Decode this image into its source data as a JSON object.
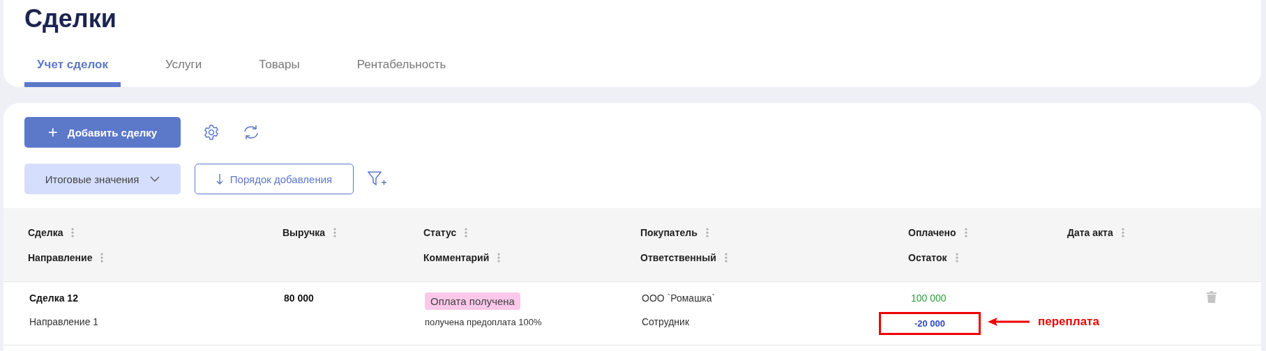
{
  "page": {
    "title": "Сделки"
  },
  "tabs": [
    {
      "label": "Учет сделок",
      "selected": true
    },
    {
      "label": "Услуги",
      "selected": false
    },
    {
      "label": "Товары",
      "selected": false
    },
    {
      "label": "Рентабельность",
      "selected": false
    }
  ],
  "toolbar": {
    "add_button": "+",
    "add_label": "Добавить сделку",
    "totals_dropdown": "Итоговые значения",
    "sort_button": "Порядок добавления"
  },
  "table": {
    "columns": [
      {
        "top": "Сделка",
        "bottom": "Направление"
      },
      {
        "top": "Выручка"
      },
      {
        "top": "Статус",
        "bottom": "Комментарий"
      },
      {
        "top": "Покупатель",
        "bottom": "Ответственный"
      },
      {
        "top": "Оплачено",
        "bottom": "Остаток"
      },
      {
        "top": "Дата акта"
      }
    ],
    "rows": [
      {
        "deal": "Сделка 12",
        "direction": "Направление 1",
        "revenue": "80 000",
        "status": "Оплата получена",
        "comment": "получена предоплата 100%",
        "buyer": "ООО `Ромашка`",
        "manager": "Сотрудник",
        "paid": "100 000",
        "remainder": "-20 000",
        "remainder_highlighted": true
      }
    ]
  },
  "annotation": {
    "text": "переплата"
  }
}
